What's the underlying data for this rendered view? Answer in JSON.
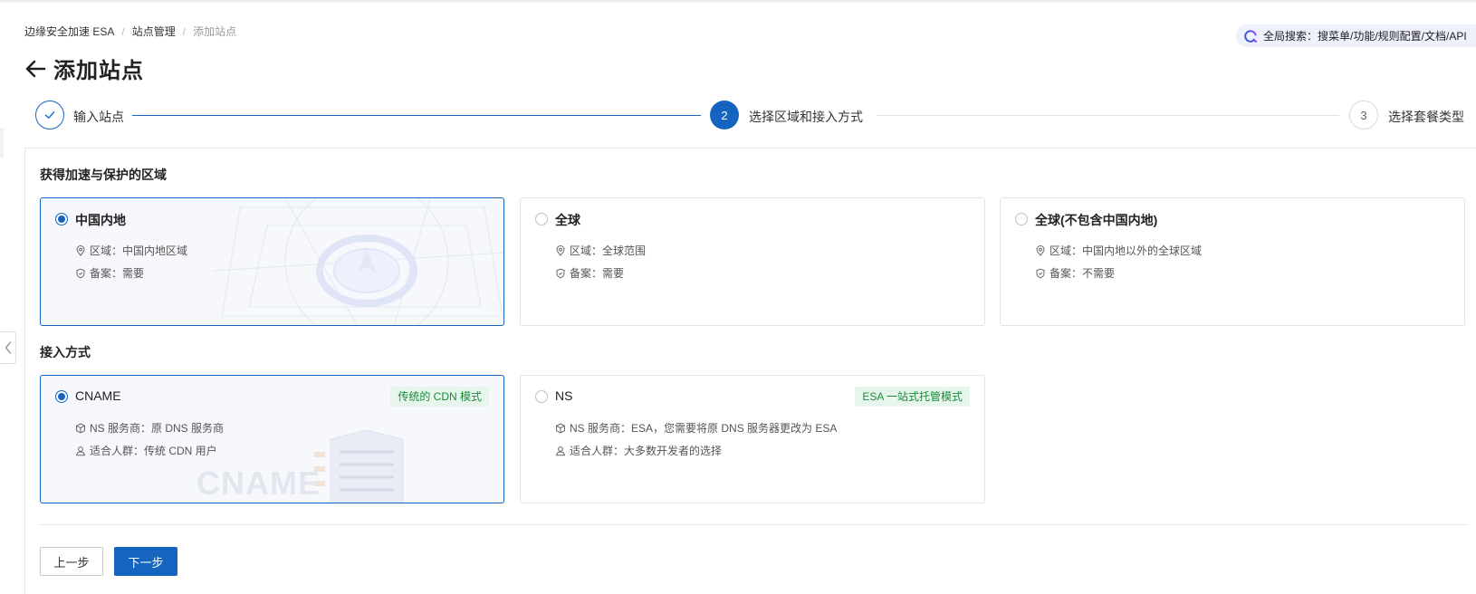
{
  "breadcrumb": {
    "items": [
      "边缘安全加速 ESA",
      "站点管理"
    ],
    "current": "添加站点",
    "separator": "/"
  },
  "global_search": {
    "label": "全局搜索：搜菜单/功能/规则配置/文档/API",
    "icon": "search-icon"
  },
  "header": {
    "title": "添加站点",
    "back_icon": "arrow-left-icon"
  },
  "steps": [
    {
      "number": "1",
      "label": "输入站点",
      "status": "finish",
      "icon": "check-icon"
    },
    {
      "number": "2",
      "label": "选择区域和接入方式",
      "status": "process"
    },
    {
      "number": "3",
      "label": "选择套餐类型",
      "status": "wait"
    }
  ],
  "region": {
    "title": "获得加速与保护的区域",
    "options": [
      {
        "label": "中国内地",
        "selected": true,
        "area_prefix": "区域：",
        "area": "中国内地区域",
        "icp_prefix": "备案：",
        "icp": "需要"
      },
      {
        "label": "全球",
        "selected": false,
        "area_prefix": "区域：",
        "area": "全球范围",
        "icp_prefix": "备案：",
        "icp": "需要"
      },
      {
        "label": "全球(不包含中国内地)",
        "selected": false,
        "area_prefix": "区域：",
        "area": "中国内地以外的全球区域",
        "icp_prefix": "备案：",
        "icp": "不需要"
      }
    ]
  },
  "access": {
    "title": "接入方式",
    "options": [
      {
        "label": "CNAME",
        "selected": true,
        "tag": "传统的 CDN 模式",
        "ns_prefix": "NS 服务商：",
        "ns": "原 DNS 服务商",
        "audience_prefix": "适合人群：",
        "audience": "传统 CDN 用户",
        "watermark": "CNAME"
      },
      {
        "label": "NS",
        "selected": false,
        "tag": "ESA 一站式托管模式",
        "ns_prefix": "NS 服务商：",
        "ns": "ESA，您需要将原 DNS 服务器更改为 ESA",
        "audience_prefix": "适合人群：",
        "audience": "大多数开发者的选择"
      }
    ]
  },
  "buttons": {
    "prev": "上一步",
    "next": "下一步"
  },
  "colors": {
    "primary": "#1565c0",
    "tag_text": "#1a8a3a",
    "tag_bg": "#e7f6ec",
    "selected_bg": "#f6f8fc",
    "search_bg": "#eef0fb"
  }
}
